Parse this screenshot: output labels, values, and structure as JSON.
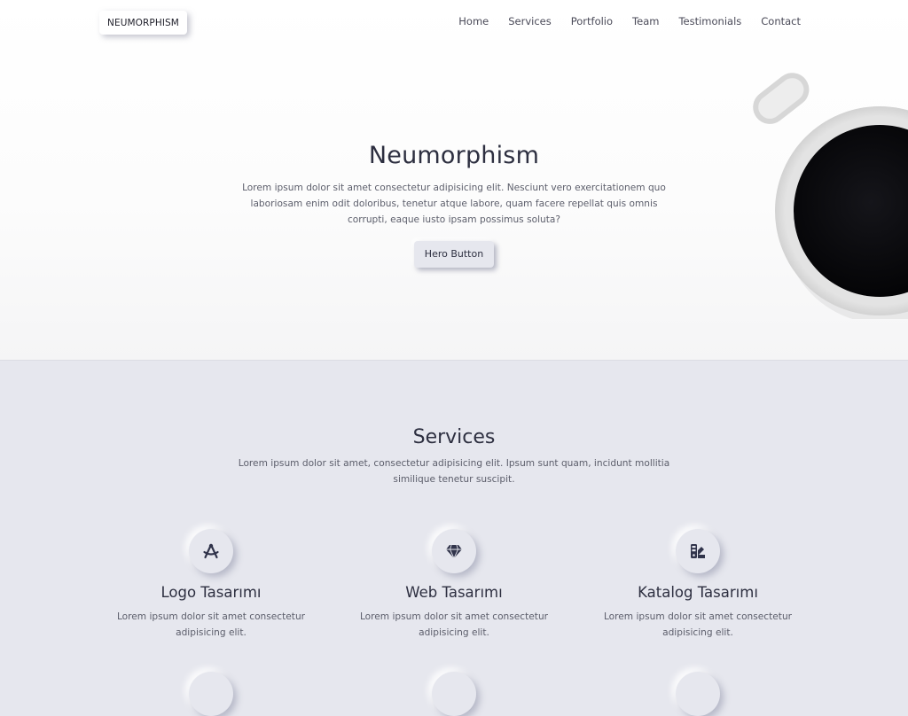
{
  "navbar": {
    "brand": "NEUMORPHISM",
    "links": [
      "Home",
      "Services",
      "Portfolio",
      "Team",
      "Testimonials",
      "Contact"
    ]
  },
  "hero": {
    "title": "Neumorphism",
    "text": "Lorem ipsum dolor sit amet consectetur adipisicing elit. Nesciunt vero exercitationem quo laboriosam enim odit doloribus, tenetur atque labore, quam facere repellat quis omnis corrupti, eaque iusto ipsam possimus soluta?",
    "button": "Hero Button"
  },
  "services": {
    "title": "Services",
    "text": "Lorem ipsum dolor sit amet, consectetur adipisicing elit. Ipsum sunt quam, incidunt mollitia similique tenetur suscipit.",
    "items": [
      {
        "icon": "drafting-compass-icon",
        "title": "Logo Tasarımı",
        "text": "Lorem ipsum dolor sit amet consectetur adipisicing elit."
      },
      {
        "icon": "gem-icon",
        "title": "Web Tasarımı",
        "text": "Lorem ipsum dolor sit amet consectetur adipisicing elit."
      },
      {
        "icon": "swatchbook-icon",
        "title": "Katalog Tasarımı",
        "text": "Lorem ipsum dolor sit amet consectetur adipisicing elit."
      }
    ]
  },
  "colors": {
    "background": "#e6e7ee",
    "text": "#2d2f40",
    "icon": "#31344b"
  }
}
